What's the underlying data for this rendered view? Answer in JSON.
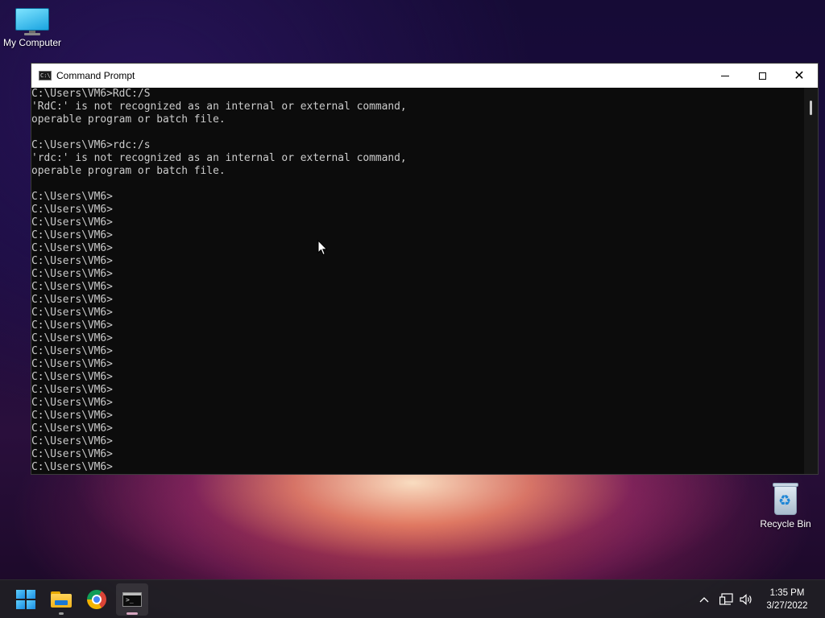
{
  "desktop": {
    "icons": [
      {
        "label": "My Computer",
        "icon": "computer-icon"
      },
      {
        "label": "Recycle Bin",
        "icon": "recycle-bin-icon"
      }
    ]
  },
  "window": {
    "title": "Command Prompt",
    "controls": {
      "minimize": "minimize",
      "maximize": "maximize",
      "close": "close"
    }
  },
  "console": {
    "lines": [
      "C:\\Users\\VM6>RdC:/S",
      "'RdC:' is not recognized as an internal or external command,",
      "operable program or batch file.",
      "",
      "C:\\Users\\VM6>rdc:/s",
      "'rdc:' is not recognized as an internal or external command,",
      "operable program or batch file.",
      "",
      "C:\\Users\\VM6>",
      "C:\\Users\\VM6>",
      "C:\\Users\\VM6>",
      "C:\\Users\\VM6>",
      "C:\\Users\\VM6>",
      "C:\\Users\\VM6>",
      "C:\\Users\\VM6>",
      "C:\\Users\\VM6>",
      "C:\\Users\\VM6>",
      "C:\\Users\\VM6>",
      "C:\\Users\\VM6>",
      "C:\\Users\\VM6>",
      "C:\\Users\\VM6>",
      "C:\\Users\\VM6>",
      "C:\\Users\\VM6>",
      "C:\\Users\\VM6>",
      "C:\\Users\\VM6>",
      "C:\\Users\\VM6>",
      "C:\\Users\\VM6>",
      "C:\\Users\\VM6>",
      "C:\\Users\\VM6>",
      "C:\\Users\\VM6>",
      "C:\\Users\\VM6>",
      "C:\\Users\\VM6>"
    ]
  },
  "taskbar": {
    "apps": [
      {
        "name": "start",
        "icon": "windows-logo-icon"
      },
      {
        "name": "file-explorer",
        "icon": "folder-icon"
      },
      {
        "name": "chrome",
        "icon": "chrome-icon"
      },
      {
        "name": "command-prompt",
        "icon": "cmd-icon",
        "active": true
      }
    ],
    "tray": {
      "chevron": "^",
      "network_icon": "network-icon",
      "volume_icon": "volume-icon"
    },
    "clock": {
      "time": "1:35 PM",
      "date": "3/27/2022"
    }
  },
  "colors": {
    "console_bg": "#0c0c0c",
    "console_text": "#cccccc",
    "title_bar": "#ffffff",
    "taskbar": "#202024"
  }
}
